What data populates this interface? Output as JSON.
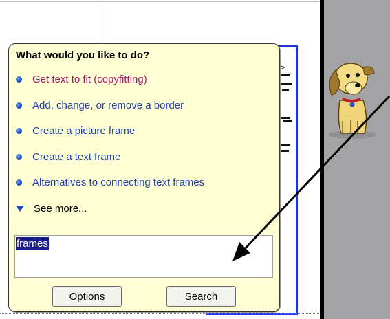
{
  "balloon": {
    "title": "What would you like to do?",
    "options": [
      {
        "label": "Get text to fit (copyfitting)",
        "visited": true
      },
      {
        "label": "Add, change, or remove a border",
        "visited": false
      },
      {
        "label": "Create a picture frame",
        "visited": false
      },
      {
        "label": "Create a text frame",
        "visited": false
      },
      {
        "label": "Alternatives to connecting text frames",
        "visited": false
      }
    ],
    "see_more": "See more...",
    "search_value": "frames",
    "buttons": {
      "options_label": "Options",
      "search_label": "Search"
    }
  },
  "colors": {
    "balloon_bg": "#ffffd5",
    "link": "#203fae",
    "visited_link": "#a0206a",
    "frame_border": "#2233d6",
    "pasteboard": "#a3a3a6",
    "selection": "#1c1c8c"
  },
  "icons": {
    "bullet": "blue-sphere-bullet-icon",
    "see_more": "triangle-down-icon",
    "assistant": "office-assistant-dog-icon"
  }
}
